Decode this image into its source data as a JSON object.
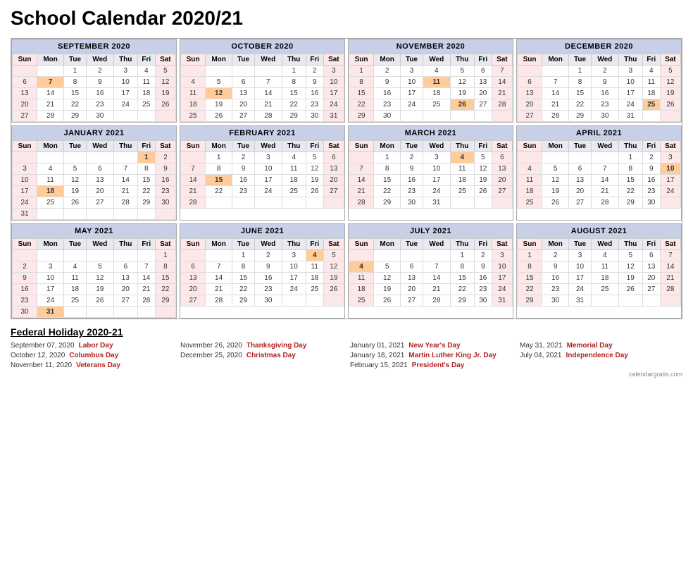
{
  "title": "School Calendar 2020/21",
  "months": [
    {
      "name": "SEPTEMBER 2020",
      "startDay": 2,
      "days": 30,
      "weeks": [
        [
          "",
          "",
          "1",
          "2",
          "3",
          "4",
          "5"
        ],
        [
          "6",
          "7",
          "8",
          "9",
          "10",
          "11",
          "12"
        ],
        [
          "13",
          "14",
          "15",
          "16",
          "17",
          "18",
          "19"
        ],
        [
          "20",
          "21",
          "22",
          "23",
          "24",
          "25",
          "26"
        ],
        [
          "27",
          "28",
          "29",
          "30",
          "",
          "",
          ""
        ]
      ],
      "holidays": [
        7
      ],
      "highlights": []
    },
    {
      "name": "OCTOBER 2020",
      "startDay": 4,
      "days": 31,
      "weeks": [
        [
          "",
          "",
          "",
          "",
          "1",
          "2",
          "3"
        ],
        [
          "4",
          "5",
          "6",
          "7",
          "8",
          "9",
          "10"
        ],
        [
          "11",
          "12",
          "13",
          "14",
          "15",
          "16",
          "17"
        ],
        [
          "18",
          "19",
          "20",
          "21",
          "22",
          "23",
          "24"
        ],
        [
          "25",
          "26",
          "27",
          "28",
          "29",
          "30",
          "31"
        ]
      ],
      "holidays": [
        12
      ],
      "highlights": []
    },
    {
      "name": "NOVEMBER 2020",
      "startDay": 0,
      "days": 30,
      "weeks": [
        [
          "1",
          "2",
          "3",
          "4",
          "5",
          "6",
          "7"
        ],
        [
          "8",
          "9",
          "10",
          "11",
          "12",
          "13",
          "14"
        ],
        [
          "15",
          "16",
          "17",
          "18",
          "19",
          "20",
          "21"
        ],
        [
          "22",
          "23",
          "24",
          "25",
          "26",
          "27",
          "28"
        ],
        [
          "29",
          "30",
          "",
          "",
          "",
          "",
          ""
        ]
      ],
      "holidays": [
        11,
        26
      ],
      "highlights": []
    },
    {
      "name": "DECEMBER 2020",
      "startDay": 2,
      "days": 31,
      "weeks": [
        [
          "",
          "",
          "1",
          "2",
          "3",
          "4",
          "5"
        ],
        [
          "6",
          "7",
          "8",
          "9",
          "10",
          "11",
          "12"
        ],
        [
          "13",
          "14",
          "15",
          "16",
          "17",
          "18",
          "19"
        ],
        [
          "20",
          "21",
          "22",
          "23",
          "24",
          "25",
          "26"
        ],
        [
          "27",
          "28",
          "29",
          "30",
          "31",
          "",
          ""
        ]
      ],
      "holidays": [
        25
      ],
      "highlights": []
    },
    {
      "name": "JANUARY 2021",
      "startDay": 5,
      "days": 31,
      "weeks": [
        [
          "",
          "",
          "",
          "",
          "",
          "1",
          "2"
        ],
        [
          "3",
          "4",
          "5",
          "6",
          "7",
          "8",
          "9"
        ],
        [
          "10",
          "11",
          "12",
          "13",
          "14",
          "15",
          "16"
        ],
        [
          "17",
          "18",
          "19",
          "20",
          "21",
          "22",
          "23"
        ],
        [
          "24",
          "25",
          "26",
          "27",
          "28",
          "29",
          "30"
        ],
        [
          "31",
          "",
          "",
          "",
          "",
          "",
          ""
        ]
      ],
      "holidays": [
        1,
        18
      ],
      "highlights": []
    },
    {
      "name": "FEBRUARY 2021",
      "startDay": 1,
      "days": 28,
      "weeks": [
        [
          "",
          "1",
          "2",
          "3",
          "4",
          "5",
          "6"
        ],
        [
          "7",
          "8",
          "9",
          "10",
          "11",
          "12",
          "13"
        ],
        [
          "14",
          "15",
          "16",
          "17",
          "18",
          "19",
          "20"
        ],
        [
          "21",
          "22",
          "23",
          "24",
          "25",
          "26",
          "27"
        ],
        [
          "28",
          "",
          "",
          "",
          "",
          "",
          ""
        ]
      ],
      "holidays": [
        15
      ],
      "highlights": []
    },
    {
      "name": "MARCH 2021",
      "startDay": 1,
      "days": 31,
      "weeks": [
        [
          "",
          "1",
          "2",
          "3",
          "4",
          "5",
          "6"
        ],
        [
          "7",
          "8",
          "9",
          "10",
          "11",
          "12",
          "13"
        ],
        [
          "14",
          "15",
          "16",
          "17",
          "18",
          "19",
          "20"
        ],
        [
          "21",
          "22",
          "23",
          "24",
          "25",
          "26",
          "27"
        ],
        [
          "28",
          "29",
          "30",
          "31",
          "",
          "",
          ""
        ]
      ],
      "holidays": [
        4
      ],
      "highlights": []
    },
    {
      "name": "APRIL 2021",
      "startDay": 4,
      "days": 30,
      "weeks": [
        [
          "",
          "",
          "",
          "",
          "1",
          "2",
          "3"
        ],
        [
          "4",
          "5",
          "6",
          "7",
          "8",
          "9",
          "10"
        ],
        [
          "11",
          "12",
          "13",
          "14",
          "15",
          "16",
          "17"
        ],
        [
          "18",
          "19",
          "20",
          "21",
          "22",
          "23",
          "24"
        ],
        [
          "25",
          "26",
          "27",
          "28",
          "29",
          "30",
          ""
        ]
      ],
      "holidays": [
        10
      ],
      "highlights": []
    },
    {
      "name": "MAY 2021",
      "startDay": 6,
      "days": 31,
      "weeks": [
        [
          "",
          "",
          "",
          "",
          "",
          "",
          "1"
        ],
        [
          "2",
          "3",
          "4",
          "5",
          "6",
          "7",
          "8"
        ],
        [
          "9",
          "10",
          "11",
          "12",
          "13",
          "14",
          "15"
        ],
        [
          "16",
          "17",
          "18",
          "19",
          "20",
          "21",
          "22"
        ],
        [
          "23",
          "24",
          "25",
          "26",
          "27",
          "28",
          "29"
        ],
        [
          "30",
          "31",
          "",
          "",
          "",
          "",
          ""
        ]
      ],
      "holidays": [
        31
      ],
      "highlights": []
    },
    {
      "name": "JUNE 2021",
      "startDay": 2,
      "days": 30,
      "weeks": [
        [
          "",
          "",
          "1",
          "2",
          "3",
          "4",
          "5"
        ],
        [
          "6",
          "7",
          "8",
          "9",
          "10",
          "11",
          "12"
        ],
        [
          "13",
          "14",
          "15",
          "16",
          "17",
          "18",
          "19"
        ],
        [
          "20",
          "21",
          "22",
          "23",
          "24",
          "25",
          "26"
        ],
        [
          "27",
          "28",
          "29",
          "30",
          "",
          "",
          ""
        ]
      ],
      "holidays": [
        4
      ],
      "highlights": []
    },
    {
      "name": "JULY 2021",
      "startDay": 4,
      "days": 31,
      "weeks": [
        [
          "",
          "",
          "",
          "",
          "1",
          "2",
          "3"
        ],
        [
          "4",
          "5",
          "6",
          "7",
          "8",
          "9",
          "10"
        ],
        [
          "11",
          "12",
          "13",
          "14",
          "15",
          "16",
          "17"
        ],
        [
          "18",
          "19",
          "20",
          "21",
          "22",
          "23",
          "24"
        ],
        [
          "25",
          "26",
          "27",
          "28",
          "29",
          "30",
          "31"
        ]
      ],
      "holidays": [
        4
      ],
      "highlights": []
    },
    {
      "name": "AUGUST 2021",
      "startDay": 0,
      "days": 31,
      "weeks": [
        [
          "1",
          "2",
          "3",
          "4",
          "5",
          "6",
          "7"
        ],
        [
          "8",
          "9",
          "10",
          "11",
          "12",
          "13",
          "14"
        ],
        [
          "15",
          "16",
          "17",
          "18",
          "19",
          "20",
          "21"
        ],
        [
          "22",
          "23",
          "24",
          "25",
          "26",
          "27",
          "28"
        ],
        [
          "29",
          "30",
          "31",
          "",
          "",
          "",
          ""
        ]
      ],
      "holidays": [],
      "highlights": []
    }
  ],
  "holidays": [
    {
      "date": "September 07, 2020",
      "name": "Labor Day"
    },
    {
      "date": "October 12, 2020",
      "name": "Columbus Day"
    },
    {
      "date": "November 11, 2020",
      "name": "Veterans Day"
    },
    {
      "date": "November 26, 2020",
      "name": "Thanksgiving Day"
    },
    {
      "date": "December 25, 2020",
      "name": "Christmas Day"
    },
    {
      "date": "January 01, 2021",
      "name": "New Year's Day"
    },
    {
      "date": "January 18, 2021",
      "name": "Martin Luther King Jr. Day"
    },
    {
      "date": "February 15, 2021",
      "name": "President's Day"
    },
    {
      "date": "May 31, 2021",
      "name": "Memorial Day"
    },
    {
      "date": "July 04, 2021",
      "name": "Independence Day"
    }
  ],
  "holidays_title": "Federal Holiday 2020-21",
  "watermark": "calendargratis.com",
  "days_header": [
    "Sun",
    "Mon",
    "Tue",
    "Wed",
    "Thu",
    "Fri",
    "Sat"
  ]
}
